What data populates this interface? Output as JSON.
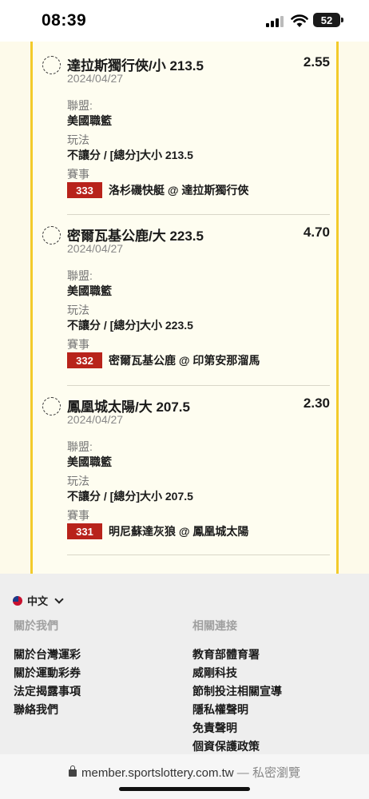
{
  "status_bar": {
    "time": "08:39",
    "battery": "52"
  },
  "bets": [
    {
      "title": "達拉斯獨行俠/小 213.5",
      "odds": "2.55",
      "date": "2024/04/27",
      "league_label": "聯盟:",
      "league": "美國職籃",
      "play_label": "玩法",
      "play": "不讓分 / [總分]大小 213.5",
      "event_label": "賽事",
      "match_no": "333",
      "match": "洛杉磯快艇 @ 達拉斯獨行俠"
    },
    {
      "title": "密爾瓦基公鹿/大 223.5",
      "odds": "4.70",
      "date": "2024/04/27",
      "league_label": "聯盟:",
      "league": "美國職籃",
      "play_label": "玩法",
      "play": "不讓分 / [總分]大小 223.5",
      "event_label": "賽事",
      "match_no": "332",
      "match": "密爾瓦基公鹿 @ 印第安那溜馬"
    },
    {
      "title": "鳳凰城太陽/大 207.5",
      "odds": "2.30",
      "date": "2024/04/27",
      "league_label": "聯盟:",
      "league": "美國職籃",
      "play_label": "玩法",
      "play": "不讓分 / [總分]大小 207.5",
      "event_label": "賽事",
      "match_no": "331",
      "match": "明尼蘇達灰狼 @ 鳳凰城太陽"
    }
  ],
  "footer": {
    "language": "中文",
    "about_heading": "關於我們",
    "about_links": [
      "關於台灣運彩",
      "關於運動彩券",
      "法定揭露事項",
      "聯絡我們"
    ],
    "related_heading": "相關連接",
    "related_links": [
      "教育部體育署",
      "威剛科技",
      "節制投注相關宣導",
      "隱私權聲明",
      "免責聲明",
      "個資保護政策"
    ]
  },
  "browser": {
    "url": "member.sportslottery.com.tw",
    "separator": " — ",
    "mode": "私密瀏覽"
  }
}
